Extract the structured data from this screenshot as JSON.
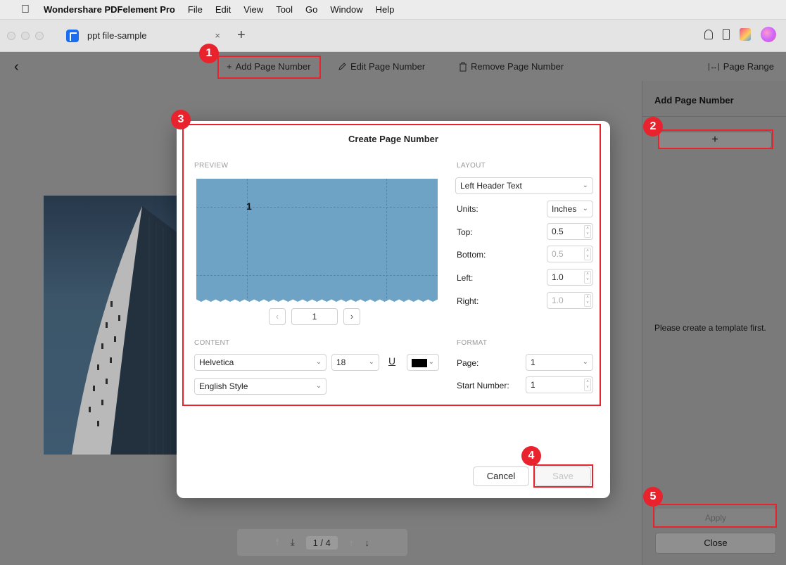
{
  "menubar": {
    "app_name": "Wondershare PDFelement Pro",
    "menus": [
      "File",
      "Edit",
      "View",
      "Tool",
      "Go",
      "Window",
      "Help"
    ]
  },
  "tab": {
    "title": "ppt file-sample",
    "close": "×",
    "add": "+"
  },
  "toolbar": {
    "add_page_number": "Add Page Number",
    "edit_page_number": "Edit Page Number",
    "remove_page_number": "Remove Page Number",
    "page_range": "Page Range"
  },
  "side_panel": {
    "title": "Add Page Number",
    "add": "+",
    "hint": "Please create a template first.",
    "apply": "Apply",
    "close": "Close"
  },
  "nav": {
    "page_indicator": "1  /  4"
  },
  "dialog": {
    "title": "Create Page Number",
    "preview_label": "PREVIEW",
    "preview_number": "1",
    "pager_value": "1",
    "content_label": "CONTENT",
    "font": "Helvetica",
    "font_size": "18",
    "underline": "U",
    "style": "English Style",
    "layout_label": "LAYOUT",
    "layout_value": "Left Header Text",
    "units_label": "Units:",
    "units_value": "Inches",
    "top_label": "Top:",
    "top_value": "0.5",
    "bottom_label": "Bottom:",
    "bottom_value": "0.5",
    "left_label": "Left:",
    "left_value": "1.0",
    "right_label": "Right:",
    "right_value": "1.0",
    "format_label": "FORMAT",
    "page_label": "Page:",
    "page_value": "1",
    "start_label": "Start Number:",
    "start_value": "1",
    "cancel": "Cancel",
    "save": "Save"
  },
  "badges": [
    "1",
    "2",
    "3",
    "4",
    "5"
  ],
  "colors": {
    "accent_red": "#e8232e",
    "preview_blue": "#6fa3c6",
    "app_blue": "#1a6df0"
  }
}
